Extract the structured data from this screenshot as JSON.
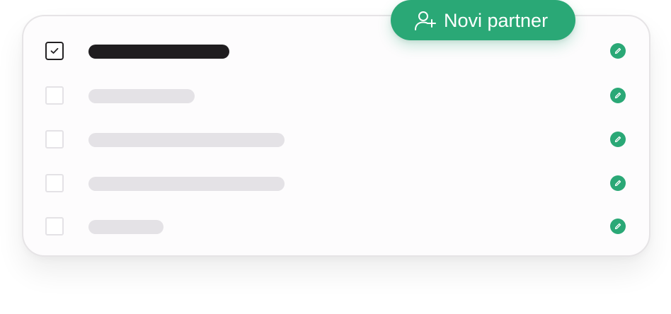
{
  "new_partner_button": {
    "label": "Novi partner",
    "icon": "user-plus-icon"
  },
  "rows": [
    {
      "checked": true,
      "bar_style": "dark"
    },
    {
      "checked": false,
      "bar_style": "light"
    },
    {
      "checked": false,
      "bar_style": "light"
    },
    {
      "checked": false,
      "bar_style": "light"
    },
    {
      "checked": false,
      "bar_style": "light"
    }
  ],
  "row_action_icon": "pencil-icon",
  "colors": {
    "accent": "#2aa876",
    "placeholder_dark": "#1f1d1f",
    "placeholder_light": "#e4e2e6",
    "card_border": "#e6e4e6"
  }
}
